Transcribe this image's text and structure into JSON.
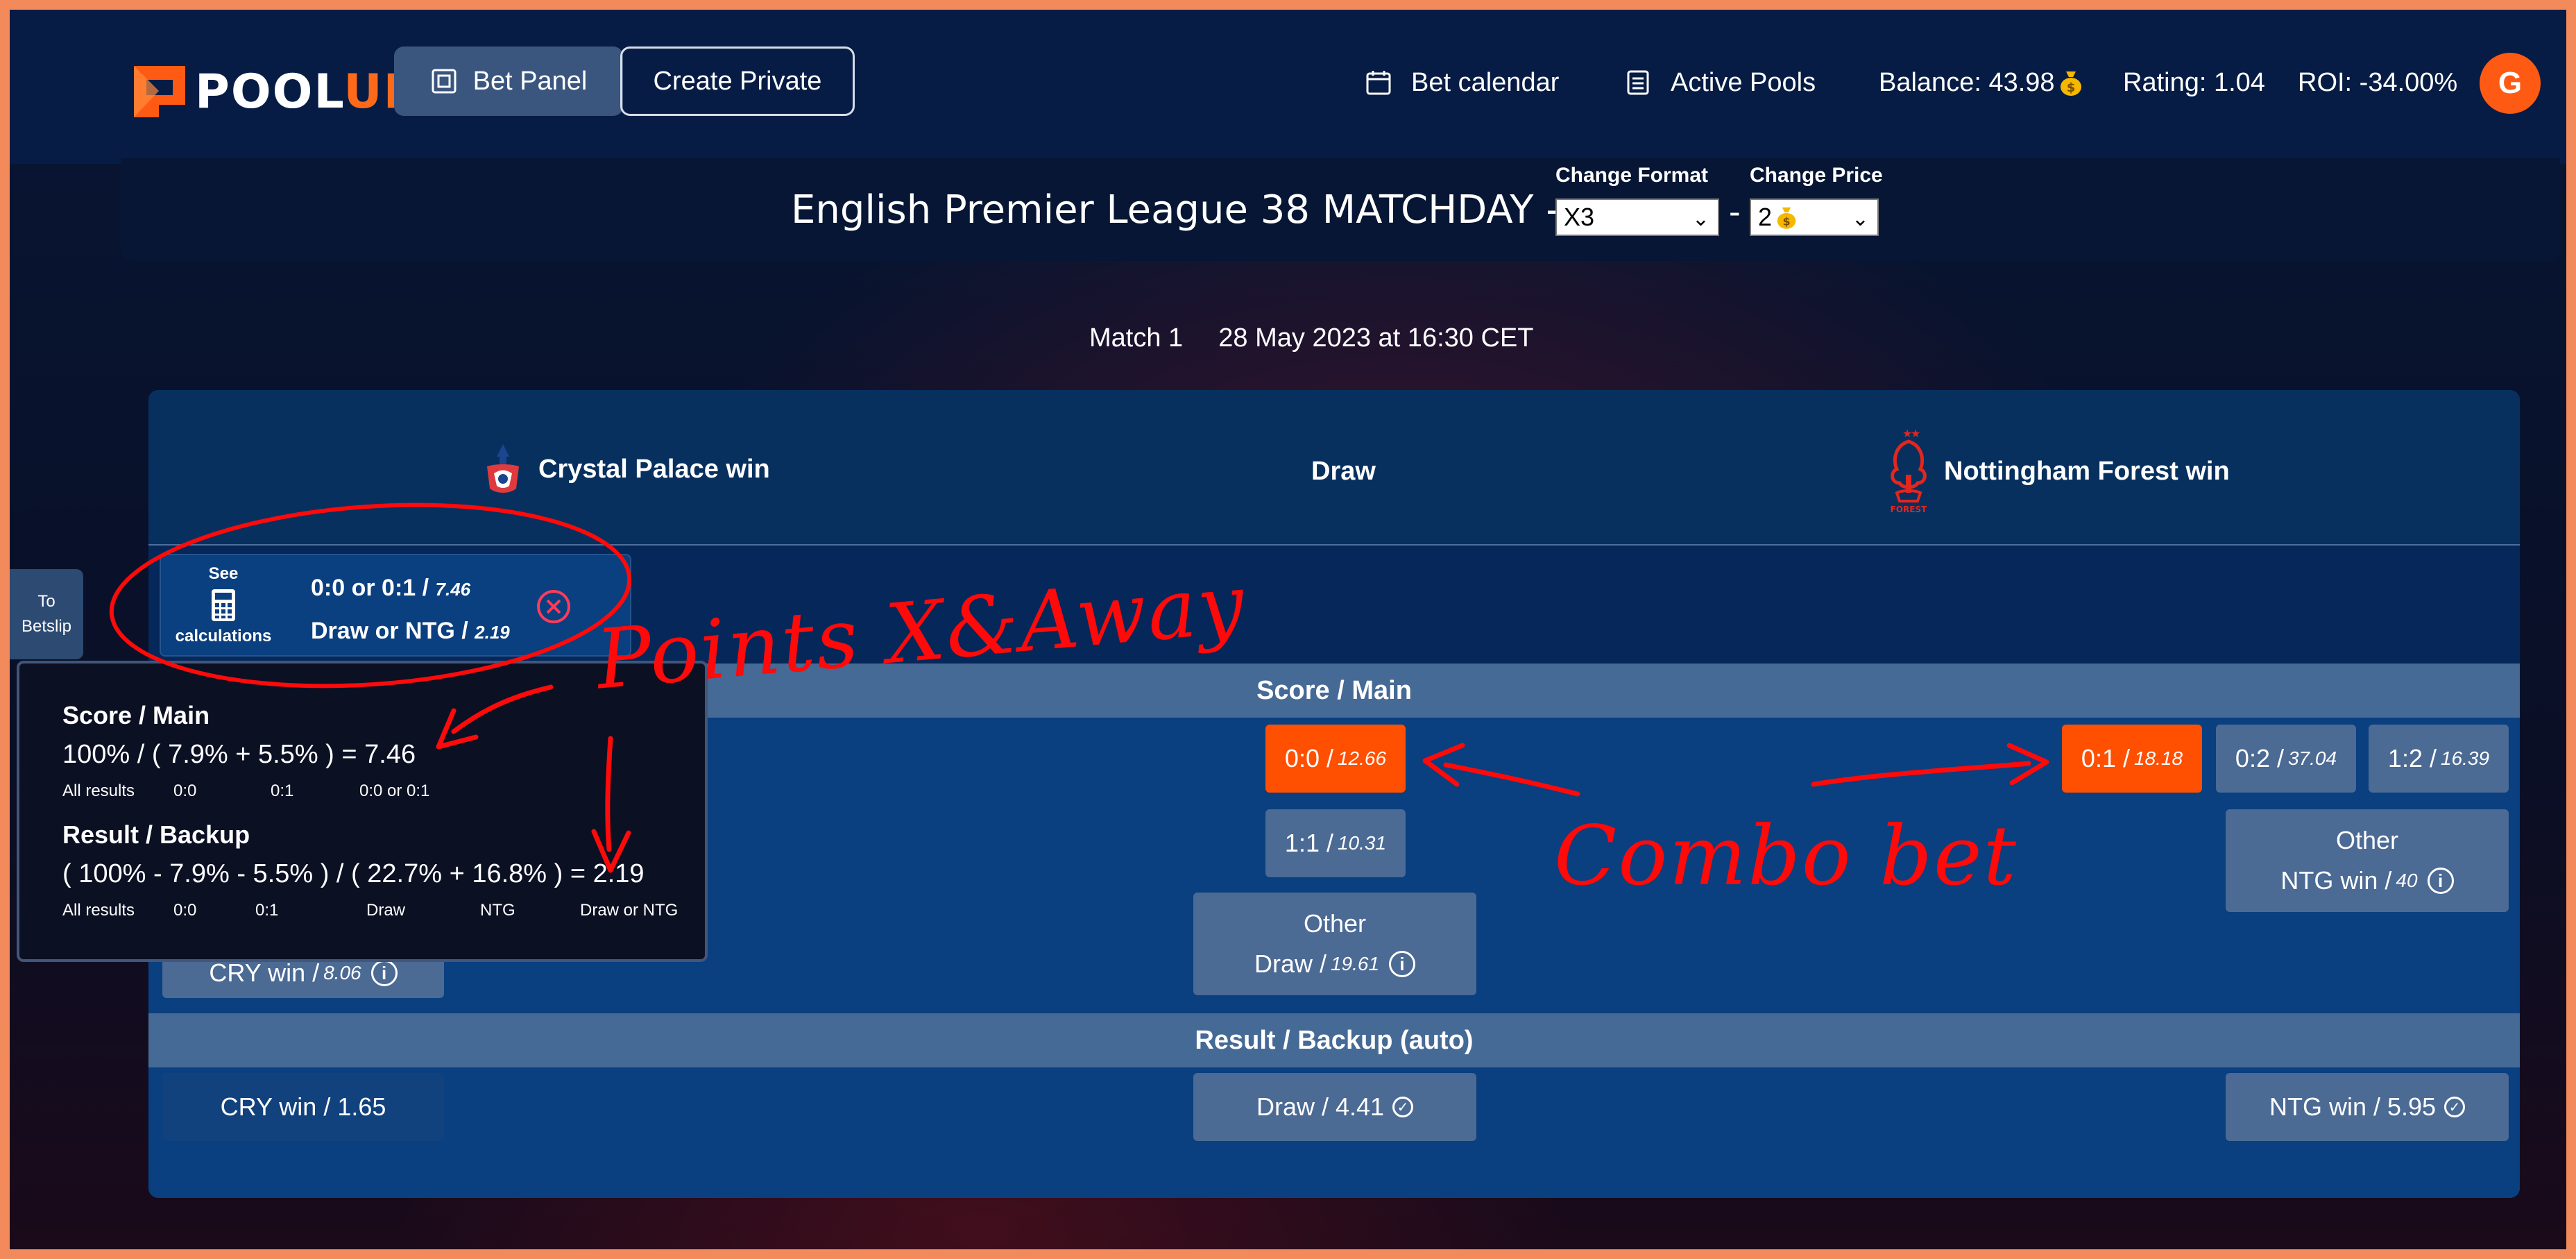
{
  "app": {
    "logo_pool": "POOL",
    "logo_up": "UP",
    "nav": {
      "bet_panel": "Bet Panel",
      "create_private": "Create Private"
    },
    "links": {
      "bet_calendar": "Bet calendar",
      "active_pools": "Active Pools"
    },
    "stats": {
      "balance": "Balance: 43.98",
      "rating": "Rating: 1.04",
      "roi": "ROI: -34.00%"
    },
    "avatar_initial": "G"
  },
  "league": {
    "title": "English Premier League 38 MATCHDAY -",
    "format_label": "Change Format",
    "format_value": "X3",
    "price_label": "Change Price",
    "price_value": "2",
    "dash": "-"
  },
  "match": {
    "number": "Match 1",
    "datetime": "28 May 2023 at 16:30 CET"
  },
  "teams": {
    "home": "Crystal Palace  win",
    "draw": "Draw",
    "away": "Nottingham Forest  win"
  },
  "betslip_chip": {
    "see": "See",
    "calculations": "calculations",
    "line1": "0:0 or 0:1 / ",
    "line1_odds": "7.46",
    "line2": "Draw or NTG / ",
    "line2_odds": "2.19"
  },
  "to_betslip": {
    "line1": "To",
    "line2": "Betslip"
  },
  "tooltip": {
    "score_title": "Score / Main",
    "score_eq": "100% / ( 7.9%   + 5.5% ) = 7.46",
    "score_sub": [
      "All results",
      "0:0",
      "0:1",
      "0:0 or 0:1"
    ],
    "result_title": "Result / Backup",
    "result_eq": "( 100% - 7.9% - 5.5% ) / ( 22.7%  + 16.8% )   = 2.19",
    "result_sub": [
      "All results",
      "0:0",
      "0:1",
      "Draw",
      "NTG",
      "Draw or NTG"
    ]
  },
  "sections": {
    "score": "Score / Main",
    "result": "Result / Backup (auto)"
  },
  "score_odds": {
    "d00_label": "0:0 / ",
    "d00_odds": "12.66",
    "d11_label": "1:1 / ",
    "d11_odds": "10.31",
    "draw_other_title": "Other",
    "draw_other_label": "Draw / ",
    "draw_other_odds": "19.61",
    "home_other_label": "CRY win / ",
    "home_other_odds": "8.06",
    "a01_label": "0:1 / ",
    "a01_odds": "18.18",
    "a02_label": "0:2 / ",
    "a02_odds": "37.04",
    "a12_label": "1:2 / ",
    "a12_odds": "16.39",
    "away_other_title": "Other",
    "away_other_label": "NTG win / ",
    "away_other_odds": "40"
  },
  "result_odds": {
    "home": "CRY win / 1.65",
    "draw": "Draw / 4.41",
    "away": "NTG win / 5.95"
  },
  "annotations": {
    "points": "Points X&Away",
    "combo": "Combo bet"
  },
  "colors": {
    "accent": "#ff4f00",
    "annotation": "#ff0a0a",
    "header": "#071c45"
  }
}
